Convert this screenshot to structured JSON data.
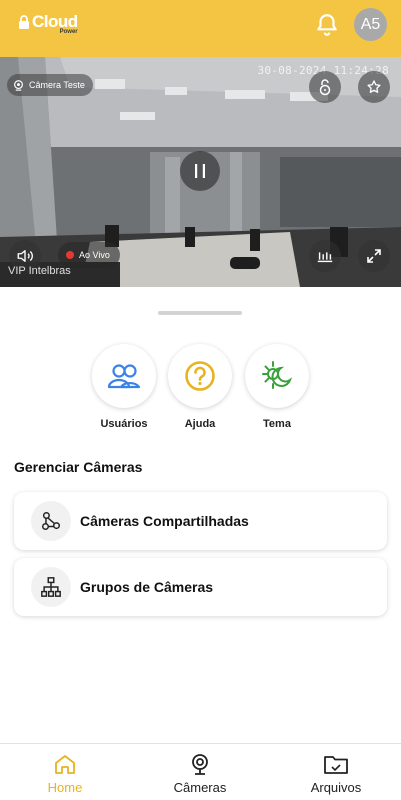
{
  "app": {
    "logo_text": "Cloud",
    "logo_sub": "Power",
    "avatar_initials": "A5",
    "accent_color": "#f4c542"
  },
  "camera": {
    "name": "Câmera Teste",
    "timestamp": "30-08-2024 11:24:28",
    "live_label": "Ao Vivo",
    "watermark": "VIP Intelbras"
  },
  "quick_actions": [
    {
      "label": "Usuários",
      "icon": "users-icon",
      "color": "#3b82e6"
    },
    {
      "label": "Ajuda",
      "icon": "help-icon",
      "color": "#e8b321"
    },
    {
      "label": "Tema",
      "icon": "theme-icon",
      "color": "#3aa03a"
    }
  ],
  "manage": {
    "title": "Gerenciar Câmeras",
    "items": [
      {
        "label": "Câmeras Compartilhadas",
        "icon": "share-icon"
      },
      {
        "label": "Grupos de Câmeras",
        "icon": "hierarchy-icon"
      }
    ]
  },
  "nav": {
    "items": [
      {
        "label": "Home",
        "icon": "home-icon",
        "active": true
      },
      {
        "label": "Câmeras",
        "icon": "webcam-icon",
        "active": false
      },
      {
        "label": "Arquivos",
        "icon": "folder-icon",
        "active": false
      }
    ]
  }
}
